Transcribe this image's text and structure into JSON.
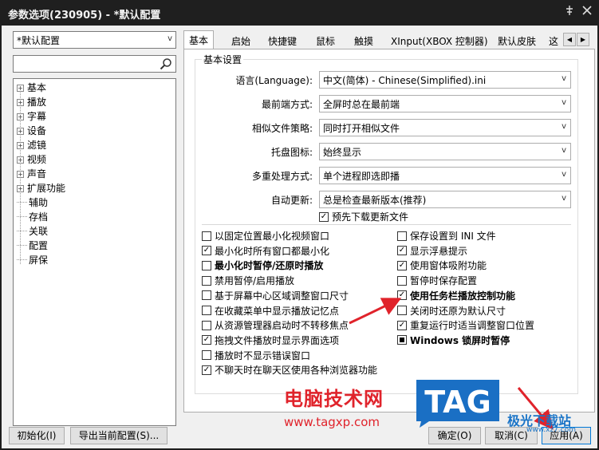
{
  "window": {
    "title": "参数选项(230905) - *默认配置"
  },
  "sidebar": {
    "profile_value": "*默认配置",
    "search_placeholder": "",
    "tree": [
      {
        "label": "基本",
        "expandable": true
      },
      {
        "label": "播放",
        "expandable": true
      },
      {
        "label": "字幕",
        "expandable": true
      },
      {
        "label": "设备",
        "expandable": true
      },
      {
        "label": "滤镜",
        "expandable": true
      },
      {
        "label": "视频",
        "expandable": true
      },
      {
        "label": "声音",
        "expandable": true
      },
      {
        "label": "扩展功能",
        "expandable": true
      },
      {
        "label": "辅助",
        "expandable": false
      },
      {
        "label": "存档",
        "expandable": false
      },
      {
        "label": "关联",
        "expandable": false
      },
      {
        "label": "配置",
        "expandable": false
      },
      {
        "label": "屏保",
        "expandable": false
      }
    ]
  },
  "tabs": [
    {
      "label": "基本",
      "active": true
    },
    {
      "label": "启始",
      "active": false
    },
    {
      "label": "快捷键",
      "active": false
    },
    {
      "label": "鼠标",
      "active": false
    },
    {
      "label": "触摸",
      "active": false
    },
    {
      "label": "XInput(XBOX 控制器)",
      "active": false
    },
    {
      "label": "默认皮肤",
      "active": false
    },
    {
      "label": "这",
      "active": false
    }
  ],
  "basic_settings": {
    "legend": "基本设置",
    "rows": [
      {
        "label": "语言(Language):",
        "value": "中文(简体) - Chinese(Simplified).ini"
      },
      {
        "label": "最前端方式:",
        "value": "全屏时总在最前端"
      },
      {
        "label": "相似文件策略:",
        "value": "同时打开相似文件"
      },
      {
        "label": "托盘图标:",
        "value": "始终显示"
      },
      {
        "label": "多重处理方式:",
        "value": "单个进程即选即播"
      },
      {
        "label": "自动更新:",
        "value": "总是检查最新版本(推荐)"
      }
    ],
    "predownload": {
      "label": "预先下载更新文件",
      "state": "checked"
    }
  },
  "options_left": [
    {
      "label": "以固定位置最小化视频窗口",
      "state": "unchecked",
      "bold": false
    },
    {
      "label": "最小化时所有窗口都最小化",
      "state": "checked",
      "bold": false
    },
    {
      "label": "最小化时暂停/还原时播放",
      "state": "unchecked",
      "bold": true
    },
    {
      "label": "禁用暂停/启用播放",
      "state": "unchecked",
      "bold": false
    },
    {
      "label": "基于屏幕中心区域调整窗口尺寸",
      "state": "unchecked",
      "bold": false
    },
    {
      "label": "在收藏菜单中显示播放记忆点",
      "state": "unchecked",
      "bold": false
    },
    {
      "label": "从资源管理器启动时不转移焦点",
      "state": "unchecked",
      "bold": false
    },
    {
      "label": "拖拽文件播放时显示界面选项",
      "state": "checked",
      "bold": false
    },
    {
      "label": "播放时不显示错误窗口",
      "state": "unchecked",
      "bold": false
    },
    {
      "label": "不聊天时在聊天区使用各种浏览器功能",
      "state": "checked",
      "bold": false
    }
  ],
  "options_right": [
    {
      "label": "保存设置到 INI 文件",
      "state": "unchecked",
      "bold": false
    },
    {
      "label": "显示浮悬提示",
      "state": "checked",
      "bold": false
    },
    {
      "label": "使用窗体吸附功能",
      "state": "checked",
      "bold": false
    },
    {
      "label": "暂停时保存配置",
      "state": "unchecked",
      "bold": false
    },
    {
      "label": "使用任务栏播放控制功能",
      "state": "checked",
      "bold": true
    },
    {
      "label": "关闭时还原为默认尺寸",
      "state": "unchecked",
      "bold": false
    },
    {
      "label": "重复运行时适当调整窗口位置",
      "state": "checked",
      "bold": false
    },
    {
      "label": "Windows 锁屏时暂停",
      "state": "indeterminate",
      "bold": true
    }
  ],
  "footer": {
    "reset_label": "初始化(I)",
    "export_label": "导出当前配置(S)...",
    "ok_label": "确定(O)",
    "cancel_label": "取消(C)",
    "apply_label": "应用(A)"
  },
  "watermarks": {
    "cn_site": "电脑技术网",
    "url": "www.tagxp.com",
    "tag": "TAG",
    "jxz": "极光下载站",
    "jxz_url": "www.xz7.com"
  },
  "colors": {
    "titlebar": "#1f1f1f",
    "dialog_bg": "#f0f0f0",
    "watermark_red": "#e0232b",
    "tag_blue": "#1a6fc4",
    "arrow_red": "#e0232b"
  }
}
